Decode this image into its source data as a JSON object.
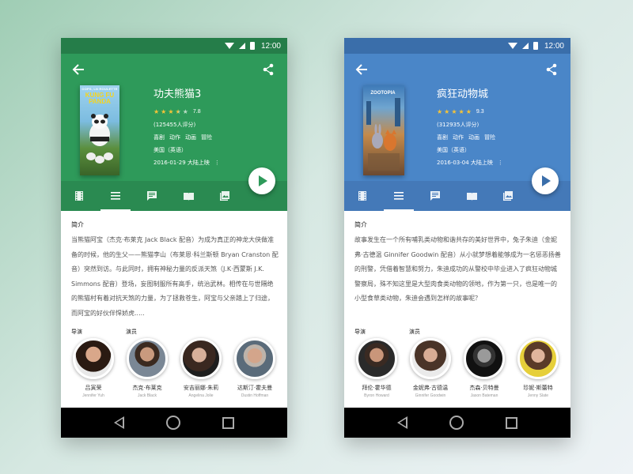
{
  "colors": {
    "green_primary": "#2e9a5a",
    "green_dark": "#257d49",
    "green_tabbar": "#2a8a51",
    "blue_primary": "#4a86c8",
    "blue_dark": "#3a6eaa",
    "blue_tabbar": "#4479b8",
    "star": "#f6c437"
  },
  "screens": [
    {
      "status": {
        "time": "12:00"
      },
      "movie": {
        "title": "功夫熊猫3",
        "poster_tagline": "OOPS, LN ROULETTE",
        "poster_logo": "KUNG FU PANDA",
        "rating_stars": 3.5,
        "score": "7.8",
        "votes": "(125455人评分)",
        "genres": [
          "喜剧",
          "动作",
          "动画",
          "冒险"
        ],
        "country": "美国（英语）",
        "release": "2016-01-29 大陆上映",
        "more": "⋮"
      },
      "tabs": [
        "film-icon",
        "list-icon",
        "comment-icon",
        "book-icon",
        "gallery-icon"
      ],
      "active_tab": 1,
      "synopsis_title": "简介",
      "synopsis": "当熊猫阿宝（杰克·布莱克 Jack Black 配音）为成为真正的神龙大侠做准备的时候，他的生父——熊猫李山（布莱恩·科兰斯顿 Bryan Cranston 配音）突然到访。与此同时，拥有神秘力量的反派天煞（J.K·西蒙斯 J.K. Simmons 配音）登场，妄图制服所有高手，统治武林。相传在与世隔绝的熊猫村有着对抗天煞的力量，为了拯救苍生，阿宝与父亲踏上了归途，而阿宝的好伙伴悍娇虎.....",
      "director_label": "导演",
      "cast_label": "演员",
      "people": [
        {
          "name": "吕寅荣",
          "name_en": "Jennifer Yuh"
        },
        {
          "name": "杰克·布莱克",
          "name_en": "Jack Black"
        },
        {
          "name": "安吉丽娜·朱莉",
          "name_en": "Angelina Jolie"
        },
        {
          "name": "达斯汀·霍夫曼",
          "name_en": "Dustin Hoffman"
        }
      ]
    },
    {
      "status": {
        "time": "12:00"
      },
      "movie": {
        "title": "疯狂动物城",
        "poster_tagline": "",
        "poster_logo": "ZOOTOPIA",
        "rating_stars": 5,
        "score": "9.3",
        "votes": "(312935人评分)",
        "genres": [
          "喜剧",
          "动作",
          "动画",
          "冒险"
        ],
        "country": "美国（英语）",
        "release": "2016-03-04 大陆上映",
        "more": "⋮"
      },
      "tabs": [
        "film-icon",
        "list-icon",
        "comment-icon",
        "book-icon",
        "gallery-icon"
      ],
      "active_tab": 1,
      "synopsis_title": "简介",
      "synopsis": "故事发生在一个所有哺乳类动物和谐共存的美好世界中，兔子朱迪（金妮弗·古德温 Ginnifer Goodwin 配音）从小就梦想着能够成为一名惩恶扬善的刑警，凭借着智慧和努力，朱迪成功的从警校中毕业进入了疯狂动物城警察局，殊不知这里是大型肉食类动物的领地，作为第一只，也是唯一的小型食草类动物，朱迪会遇到怎样的故事呢？",
      "director_label": "导演",
      "cast_label": "演员",
      "people": [
        {
          "name": "拜伦·霍华德",
          "name_en": "Byron Howard"
        },
        {
          "name": "金妮弗·古德温",
          "name_en": "Ginnifer Goodwin"
        },
        {
          "name": "杰森·贝特曼",
          "name_en": "Jason Bateman"
        },
        {
          "name": "珍妮·斯蕾特",
          "name_en": "Jenny Slate"
        }
      ]
    }
  ]
}
